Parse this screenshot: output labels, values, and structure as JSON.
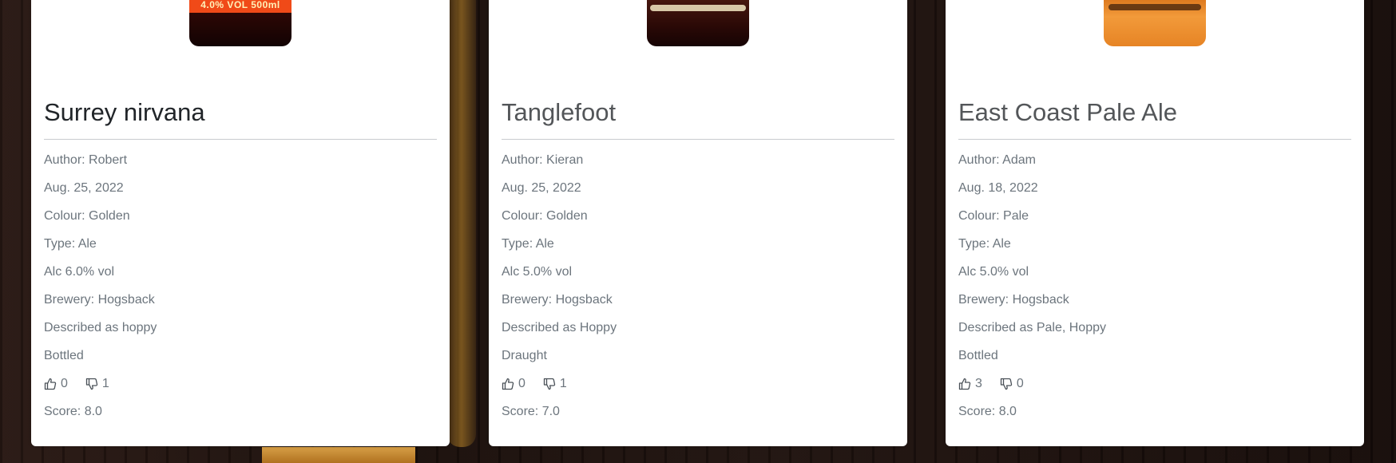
{
  "bottles": {
    "card1_label": "4.0% VOL 500ml"
  },
  "cards": [
    {
      "title": "Surrey nirvana",
      "author": "Author: Robert",
      "date": "Aug. 25, 2022",
      "colour": "Colour: Golden",
      "type": "Type: Ale",
      "alc": "Alc 6.0% vol",
      "brewery": "Brewery: Hogsback",
      "described": "Described as hoppy",
      "serving": "Bottled",
      "likes": "0",
      "dislikes": "1",
      "score": "Score: 8.0"
    },
    {
      "title": "Tanglefoot",
      "author": "Author: Kieran",
      "date": "Aug. 25, 2022",
      "colour": "Colour: Golden",
      "type": "Type: Ale",
      "alc": "Alc 5.0% vol",
      "brewery": "Brewery: Hogsback",
      "described": "Described as Hoppy",
      "serving": "Draught",
      "likes": "0",
      "dislikes": "1",
      "score": "Score: 7.0"
    },
    {
      "title": "East Coast Pale Ale",
      "author": "Author: Adam",
      "date": "Aug. 18, 2022",
      "colour": "Colour: Pale",
      "type": "Type: Ale",
      "alc": "Alc 5.0% vol",
      "brewery": "Brewery: Hogsback",
      "described": "Described as Pale, Hoppy",
      "serving": "Bottled",
      "likes": "3",
      "dislikes": "0",
      "score": "Score: 8.0"
    }
  ],
  "icons": {
    "like": "thumbs-up-icon",
    "dislike": "thumbs-down-icon"
  },
  "colors": {
    "title_dark": "#212529",
    "title_muted": "#535659",
    "text_muted": "#6c757d",
    "card_bg": "#ffffff"
  }
}
